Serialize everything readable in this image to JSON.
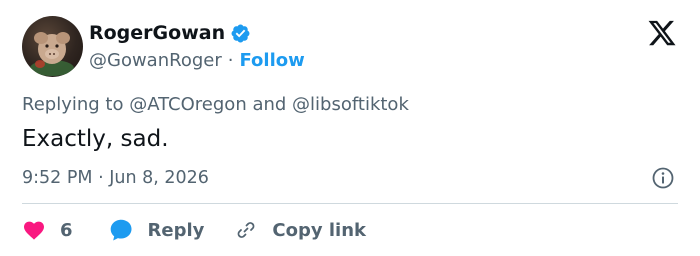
{
  "author": {
    "display_name": "RogerGowan",
    "handle": "@GowanRoger",
    "separator": "·",
    "follow_label": "Follow"
  },
  "reply_context": {
    "prefix": "Replying to ",
    "mention_1": "@ATCOregon",
    "joiner": " and ",
    "mention_2": "@libsoftiktok"
  },
  "tweet": {
    "text": "Exactly, sad."
  },
  "meta": {
    "time": "9:52 PM",
    "separator": " · ",
    "date": "Jun 8, 2026"
  },
  "actions": {
    "like_count": "6",
    "reply_label": "Reply",
    "copy_link_label": "Copy link"
  },
  "colors": {
    "accent": "#1d9bf0",
    "like": "#f91880",
    "text": "#0f1419",
    "secondary": "#536471",
    "divider": "#cfd9de"
  },
  "icons": [
    "verified-badge-icon",
    "x-logo-icon",
    "info-icon",
    "heart-icon",
    "reply-bubble-icon",
    "link-icon"
  ]
}
